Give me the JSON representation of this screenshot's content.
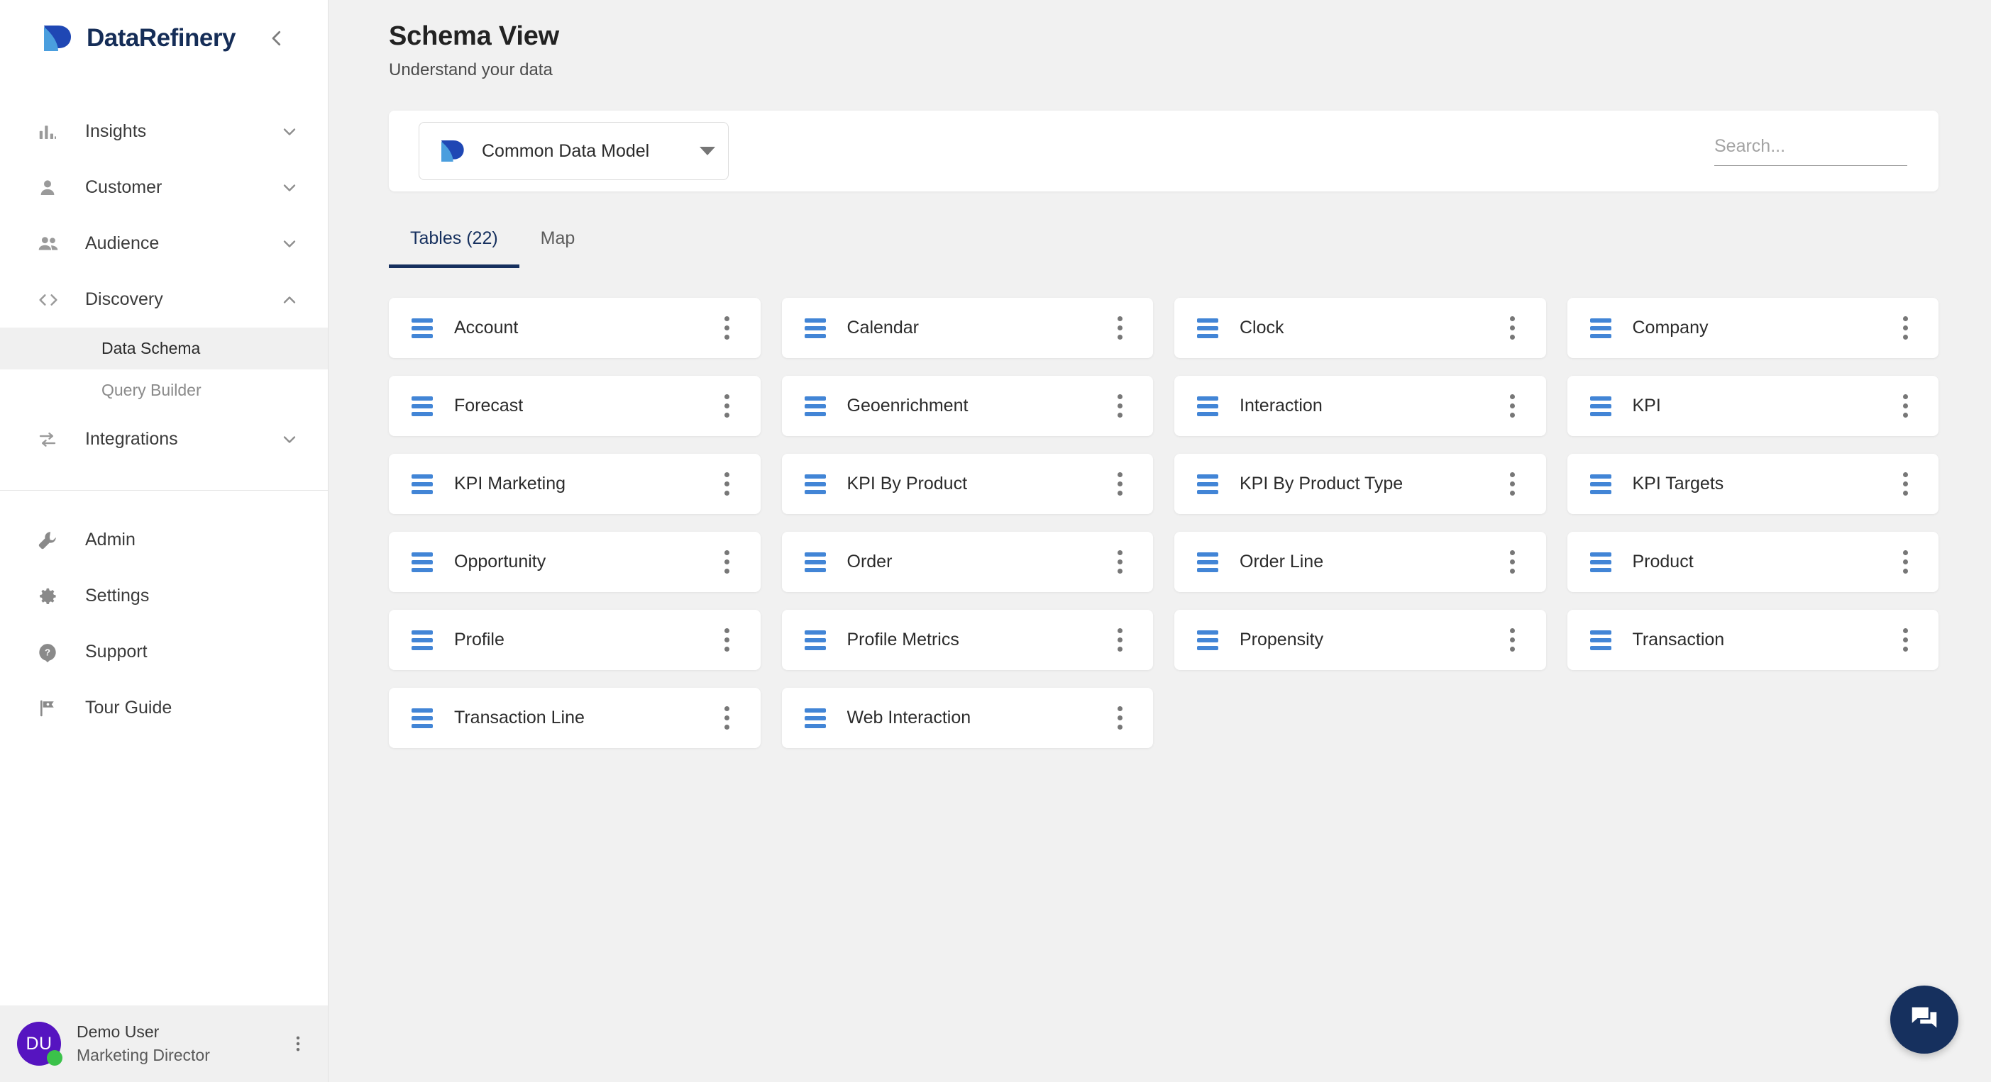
{
  "brand": {
    "name": "DataRefinery",
    "collapse_icon": "chevron-left-icon"
  },
  "sidebar": {
    "nav": [
      {
        "label": "Insights",
        "icon": "bar-chart-icon",
        "expandable": true,
        "expanded": false
      },
      {
        "label": "Customer",
        "icon": "person-icon",
        "expandable": true,
        "expanded": false
      },
      {
        "label": "Audience",
        "icon": "people-icon",
        "expandable": true,
        "expanded": false
      },
      {
        "label": "Discovery",
        "icon": "code-icon",
        "expandable": true,
        "expanded": true
      },
      {
        "label": "Integrations",
        "icon": "sync-icon",
        "expandable": true,
        "expanded": false
      }
    ],
    "discovery_children": [
      {
        "label": "Data Schema",
        "active": true
      },
      {
        "label": "Query Builder",
        "active": false
      }
    ],
    "bottom_nav": [
      {
        "label": "Admin",
        "icon": "wrench-icon"
      },
      {
        "label": "Settings",
        "icon": "gear-icon"
      },
      {
        "label": "Support",
        "icon": "help-circle-icon"
      },
      {
        "label": "Tour Guide",
        "icon": "flag-icon"
      }
    ],
    "user": {
      "initials": "DU",
      "name": "Demo User",
      "role": "Marketing Director",
      "status": "online",
      "menu_icon": "more-vertical-icon"
    }
  },
  "header": {
    "title": "Schema View",
    "subtitle": "Understand your data"
  },
  "toolbar": {
    "model_selector": {
      "value": "Common Data Model",
      "icon": "datarefinery-logo-icon",
      "caret_icon": "caret-down-icon"
    },
    "search": {
      "value": "",
      "placeholder": "Search..."
    }
  },
  "tabs": [
    {
      "label": "Tables (22)",
      "active": true
    },
    {
      "label": "Map",
      "active": false
    }
  ],
  "tables": [
    "Account",
    "Calendar",
    "Clock",
    "Company",
    "Forecast",
    "Geoenrichment",
    "Interaction",
    "KPI",
    "KPI Marketing",
    "KPI By Product",
    "KPI By Product Type",
    "KPI Targets",
    "Opportunity",
    "Order",
    "Order Line",
    "Product",
    "Profile",
    "Profile Metrics",
    "Propensity",
    "Transaction",
    "Transaction Line",
    "Web Interaction"
  ],
  "table_card": {
    "icon": "table-rows-icon",
    "menu_icon": "more-vertical-icon"
  },
  "fab": {
    "icon": "chat-bubble-icon"
  },
  "colors": {
    "accent_navy": "#16305e",
    "accent_blue": "#4285d6",
    "logo_dark": "#1f47b4",
    "logo_light": "#4a9ede",
    "avatar_purple": "#5614c0",
    "status_green": "#3bc24a",
    "page_bg": "#f1f1f1",
    "card_bg": "#ffffff"
  }
}
